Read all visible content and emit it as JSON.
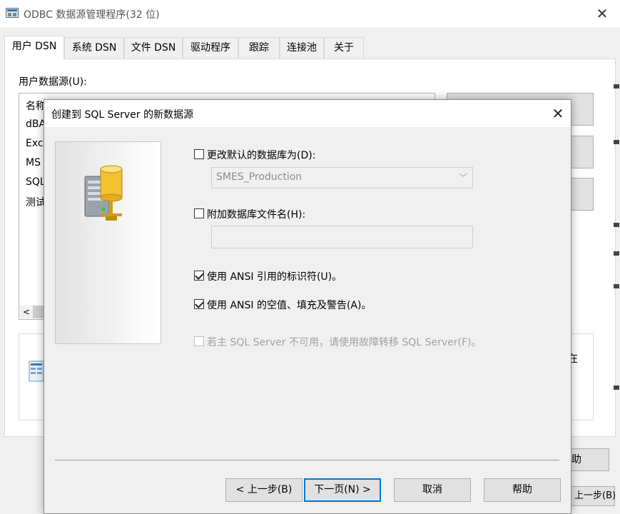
{
  "window": {
    "title": "ODBC 数据源管理程序(32 位)",
    "close_glyph": "✕"
  },
  "tabs": [
    {
      "label": "用户 DSN",
      "active": true
    },
    {
      "label": "系统 DSN",
      "active": false
    },
    {
      "label": "文件 DSN",
      "active": false
    },
    {
      "label": "驱动程序",
      "active": false
    },
    {
      "label": "跟踪",
      "active": false
    },
    {
      "label": "连接池",
      "active": false
    },
    {
      "label": "关于",
      "active": false
    }
  ],
  "user_dsn": {
    "section_label": "用户数据源(U):",
    "list_rows": [
      "名称",
      "dBA",
      "Exc",
      "MS",
      "SQL",
      "测试"
    ],
    "scroll_left_glyph": "<",
    "right_partial_text": "在",
    "help_button_partial": "助",
    "bottom_button_partial": "上一步(B)"
  },
  "dialog": {
    "title": "创建到 SQL Server 的新数据源",
    "close_glyph": "✕",
    "change_default_db": {
      "label": "更改默认的数据库为(D):",
      "checked": false,
      "select_value": "SMES_Production",
      "chevron": "﹀"
    },
    "attach_db_file": {
      "label": "附加数据库文件名(H):",
      "checked": false,
      "input_value": ""
    },
    "ansi_quoted": {
      "label": "使用 ANSI 引用的标识符(U)。",
      "checked": true
    },
    "ansi_nulls": {
      "label": "使用 ANSI 的空值、填充及警告(A)。",
      "checked": true
    },
    "failover": {
      "label": "若主 SQL Server 不可用，请使用故障转移 SQL Server(F)。",
      "checked": false,
      "disabled": true
    },
    "buttons": {
      "back": "< 上一步(B)",
      "next": "下一页(N) >",
      "cancel": "取消",
      "help": "帮助"
    }
  },
  "colors": {
    "window_bg": "#f0f0f0",
    "focus_border": "#0078d7",
    "disabled_text": "#a0a0a0"
  }
}
